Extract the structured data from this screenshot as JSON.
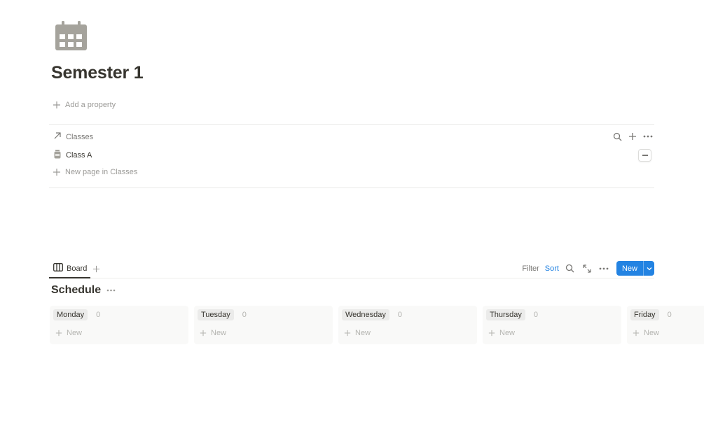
{
  "page": {
    "icon": "calendar-icon",
    "title": "Semester 1",
    "add_property_label": "Add a property"
  },
  "relation": {
    "icon": "arrow-up-right-icon",
    "label": "Classes",
    "items": [
      {
        "icon": "jar-icon",
        "label": "Class A"
      }
    ],
    "new_page_label": "New page in Classes"
  },
  "database": {
    "views": [
      {
        "icon": "board-icon",
        "label": "Board",
        "active": true
      }
    ],
    "toolbar": {
      "filter_label": "Filter",
      "sort_label": "Sort",
      "new_label": "New"
    },
    "title": "Schedule",
    "columns": [
      {
        "name": "Monday",
        "count": "0",
        "new_label": "New"
      },
      {
        "name": "Tuesday",
        "count": "0",
        "new_label": "New"
      },
      {
        "name": "Wednesday",
        "count": "0",
        "new_label": "New"
      },
      {
        "name": "Thursday",
        "count": "0",
        "new_label": "New"
      },
      {
        "name": "Friday",
        "count": "0",
        "new_label": "New"
      }
    ]
  },
  "colors": {
    "accent": "#2383e2",
    "text": "#37352f",
    "muted": "#9b9a97",
    "icon_gray": "#a5a39c"
  }
}
